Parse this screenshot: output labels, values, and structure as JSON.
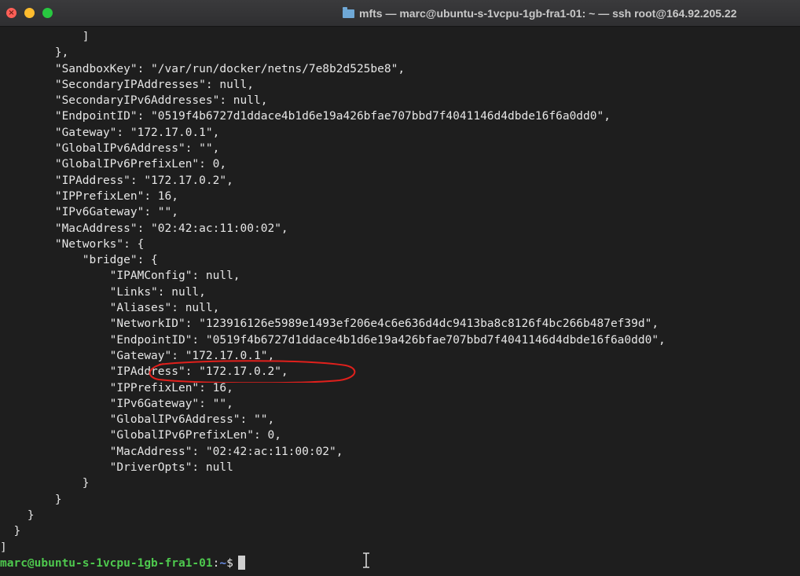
{
  "window": {
    "title": "mfts — marc@ubuntu-s-1vcpu-1gb-fra1-01: ~ — ssh root@164.92.205.22",
    "buttons": [
      "close",
      "minimize",
      "zoom"
    ],
    "title_icon": "folder-icon"
  },
  "terminal": {
    "lines": [
      "            ]",
      "        },",
      "        \"SandboxKey\": \"/var/run/docker/netns/7e8b2d525be8\",",
      "        \"SecondaryIPAddresses\": null,",
      "        \"SecondaryIPv6Addresses\": null,",
      "        \"EndpointID\": \"0519f4b6727d1ddace4b1d6e19a426bfae707bbd7f4041146d4dbde16f6a0dd0\",",
      "        \"Gateway\": \"172.17.0.1\",",
      "        \"GlobalIPv6Address\": \"\",",
      "        \"GlobalIPv6PrefixLen\": 0,",
      "        \"IPAddress\": \"172.17.0.2\",",
      "        \"IPPrefixLen\": 16,",
      "        \"IPv6Gateway\": \"\",",
      "        \"MacAddress\": \"02:42:ac:11:00:02\",",
      "        \"Networks\": {",
      "            \"bridge\": {",
      "                \"IPAMConfig\": null,",
      "                \"Links\": null,",
      "                \"Aliases\": null,",
      "                \"NetworkID\": \"123916126e5989e1493ef206e4c6e636d4dc9413ba8c8126f4bc266b487ef39d\",",
      "                \"EndpointID\": \"0519f4b6727d1ddace4b1d6e19a426bfae707bbd7f4041146d4dbde16f6a0dd0\",",
      "                \"Gateway\": \"172.17.0.1\",",
      "                \"IPAddress\": \"172.17.0.2\",",
      "                \"IPPrefixLen\": 16,",
      "                \"IPv6Gateway\": \"\",",
      "                \"GlobalIPv6Address\": \"\",",
      "                \"GlobalIPv6PrefixLen\": 0,",
      "                \"MacAddress\": \"02:42:ac:11:00:02\",",
      "                \"DriverOpts\": null",
      "            }",
      "        }",
      "    }",
      "  }",
      "]"
    ],
    "prompt": {
      "user_host": "marc@ubuntu-s-1vcpu-1gb-fra1-01",
      "separator": ":",
      "path": "~",
      "symbol": "$"
    }
  },
  "colors": {
    "background": "#1e1e1e",
    "text": "#e6e6e6",
    "prompt_user": "#4ec94e",
    "prompt_path": "#6b8fe8",
    "annotation": "#e0201c"
  }
}
